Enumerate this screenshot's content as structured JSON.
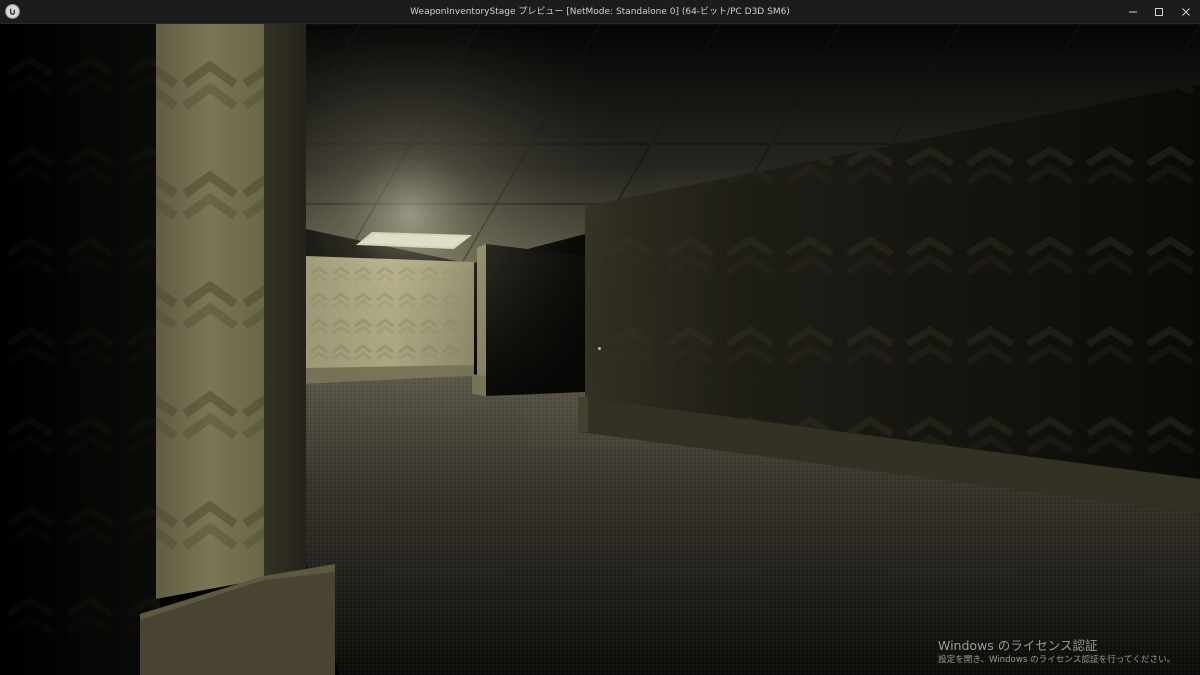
{
  "window": {
    "title": "WeaponInventoryStage プレビュー [NetMode: Standalone 0]  (64-ビット/PC D3D SM6)",
    "app_icon": "unreal-engine-logo-icon",
    "controls": {
      "minimize_icon": "minimize-icon",
      "maximize_icon": "maximize-icon",
      "close_icon": "close-icon"
    }
  },
  "scene": {
    "description_icon": "game-viewport",
    "palette": {
      "wallpaper_lit": "#c9c39a",
      "wallpaper_dark": "#2a2a1c",
      "ceiling_light": "#f4f0cf",
      "floor": "#4a463a"
    }
  },
  "watermark": {
    "title": "Windows のライセンス認証",
    "subtitle": "設定を開き、Windows のライセンス認証を行ってください。"
  }
}
